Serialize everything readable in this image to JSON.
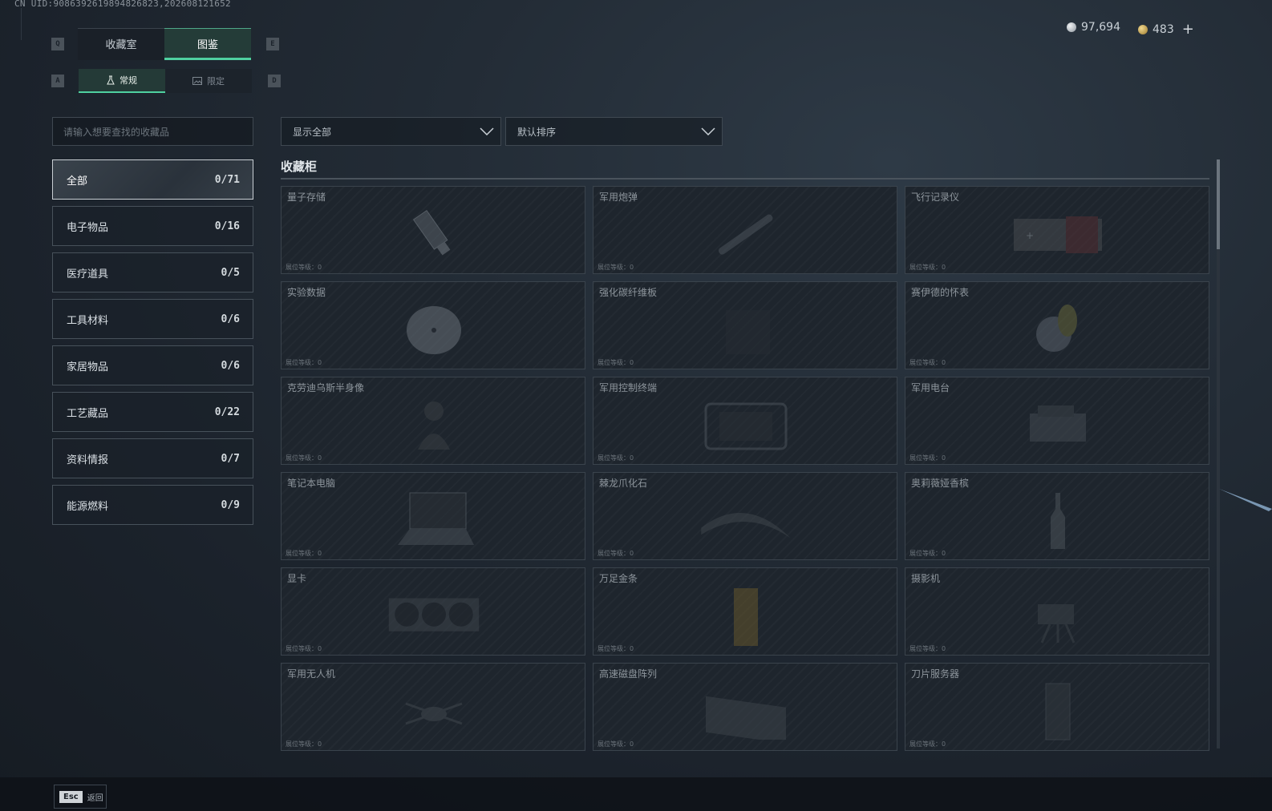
{
  "header": {
    "uid": "CN UID:9086392619894826823,20260812165​2",
    "currency": {
      "silver": "97,694",
      "gold": "483",
      "add": "+"
    }
  },
  "keys": {
    "prev_tab": "Q",
    "next_tab": "E",
    "prev_sub": "A",
    "next_sub": "D"
  },
  "tabs": [
    {
      "label": "收藏室",
      "active": false
    },
    {
      "label": "图鉴",
      "active": true
    }
  ],
  "subtabs": [
    {
      "label": "常规",
      "icon": "flask-icon",
      "active": true
    },
    {
      "label": "限定",
      "icon": "image-icon",
      "active": false
    }
  ],
  "search": {
    "placeholder": "请输入想要查找的收藏品"
  },
  "filters": {
    "show": "显示全部",
    "sort": "默认排序"
  },
  "categories": [
    {
      "label": "全部",
      "count": "0/71",
      "active": true
    },
    {
      "label": "电子物品",
      "count": "0/16"
    },
    {
      "label": "医疗道具",
      "count": "0/5"
    },
    {
      "label": "工具材料",
      "count": "0/6"
    },
    {
      "label": "家居物品",
      "count": "0/6"
    },
    {
      "label": "工艺藏品",
      "count": "0/22"
    },
    {
      "label": "资料情报",
      "count": "0/7"
    },
    {
      "label": "能源燃料",
      "count": "0/9"
    }
  ],
  "section": {
    "title": "收藏柜"
  },
  "items": [
    {
      "name": "量子存储",
      "level": "展位等级：0",
      "icon": "usb-drive-icon"
    },
    {
      "name": "军用炮弹",
      "level": "展位等级：0",
      "icon": "shell-icon"
    },
    {
      "name": "飞行记录仪",
      "level": "展位等级：0",
      "icon": "flight-recorder-icon"
    },
    {
      "name": "实验数据",
      "level": "展位等级：0",
      "icon": "disc-icon"
    },
    {
      "name": "强化碳纤维板",
      "level": "展位等级：0",
      "icon": "panel-icon"
    },
    {
      "name": "赛伊德的怀表",
      "level": "展位等级：0",
      "icon": "pocket-watch-icon"
    },
    {
      "name": "克劳迪乌斯半身像",
      "level": "展位等级：0",
      "icon": "bust-icon"
    },
    {
      "name": "军用控制终端",
      "level": "展位等级：0",
      "icon": "terminal-icon"
    },
    {
      "name": "军用电台",
      "level": "展位等级：0",
      "icon": "radio-icon"
    },
    {
      "name": "笔记本电脑",
      "level": "展位等级：0",
      "icon": "laptop-icon"
    },
    {
      "name": "棘龙爪化石",
      "level": "展位等级：0",
      "icon": "fossil-claw-icon"
    },
    {
      "name": "奥莉薇娅香槟",
      "level": "展位等级：0",
      "icon": "bottle-icon"
    },
    {
      "name": "显卡",
      "level": "展位等级：0",
      "icon": "graphics-card-icon"
    },
    {
      "name": "万足金条",
      "level": "展位等级：0",
      "icon": "gold-bar-icon"
    },
    {
      "name": "摄影机",
      "level": "展位等级：0",
      "icon": "camera-icon"
    },
    {
      "name": "军用无人机",
      "level": "展位等级：0",
      "icon": "drone-icon"
    },
    {
      "name": "高速磁盘阵列",
      "level": "展位等级：0",
      "icon": "disk-array-icon"
    },
    {
      "name": "刀片服务器",
      "level": "展位等级：0",
      "icon": "blade-server-icon"
    }
  ],
  "footer": {
    "key": "Esc",
    "label": "返回"
  }
}
